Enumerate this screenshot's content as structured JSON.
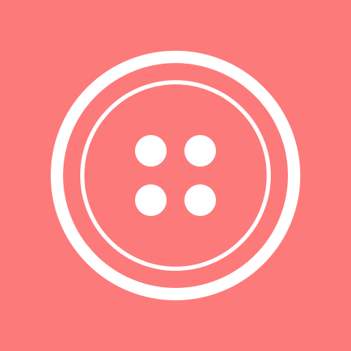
{
  "icon": {
    "name": "sewing-button-icon",
    "background_color": "#FD7A7B",
    "foreground_color": "#FFFFFF",
    "hole_count": 4
  }
}
